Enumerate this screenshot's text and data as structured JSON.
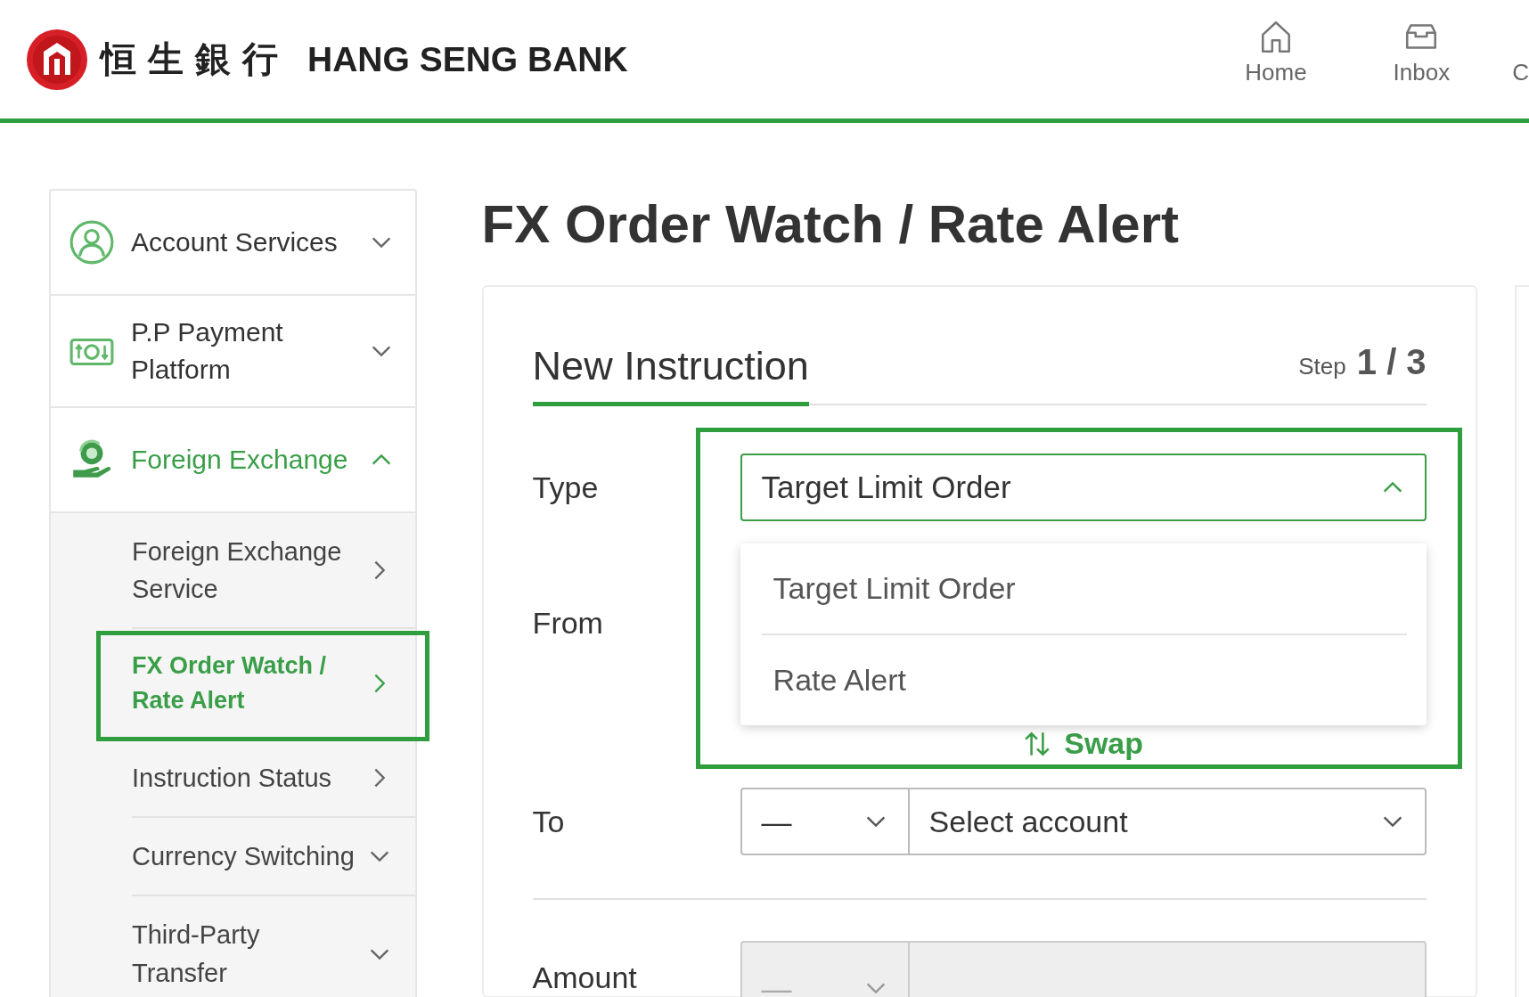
{
  "header": {
    "brand_chinese": "恒生銀行",
    "brand": "HANG SENG BANK",
    "nav": [
      {
        "label": "Home"
      },
      {
        "label": "Inbox"
      },
      {
        "label": "C"
      }
    ]
  },
  "sidebar": {
    "items": [
      {
        "label": "Account Services",
        "expanded": false
      },
      {
        "label": "P.P Payment Platform",
        "expanded": false
      },
      {
        "label": "Foreign Exchange",
        "expanded": true,
        "children": [
          {
            "label": "Foreign Exchange Service",
            "kind": "link",
            "selected": false,
            "highlighted": false
          },
          {
            "label": "FX Order Watch / Rate Alert",
            "kind": "link",
            "selected": true,
            "highlighted": true
          },
          {
            "label": "Instruction Status",
            "kind": "link",
            "selected": false,
            "highlighted": false
          },
          {
            "label": "Currency Switching",
            "kind": "group",
            "selected": false,
            "highlighted": false
          },
          {
            "label": "Third-Party Transfer",
            "kind": "group",
            "selected": false,
            "highlighted": false
          }
        ]
      }
    ]
  },
  "page_title": "FX Order Watch / Rate Alert",
  "card": {
    "tab": "New Instruction",
    "step_label": "Step",
    "step": "1 / 3",
    "type": {
      "label": "Type",
      "value": "Target Limit Order",
      "expanded": true,
      "options": [
        "Target Limit Order",
        "Rate Alert"
      ]
    },
    "from": {
      "label": "From"
    },
    "swap": "Swap",
    "to": {
      "label": "To",
      "currency": "—",
      "account_placeholder": "Select account"
    },
    "amount": {
      "label": "Amount",
      "currency": "—",
      "disabled": true
    }
  }
}
